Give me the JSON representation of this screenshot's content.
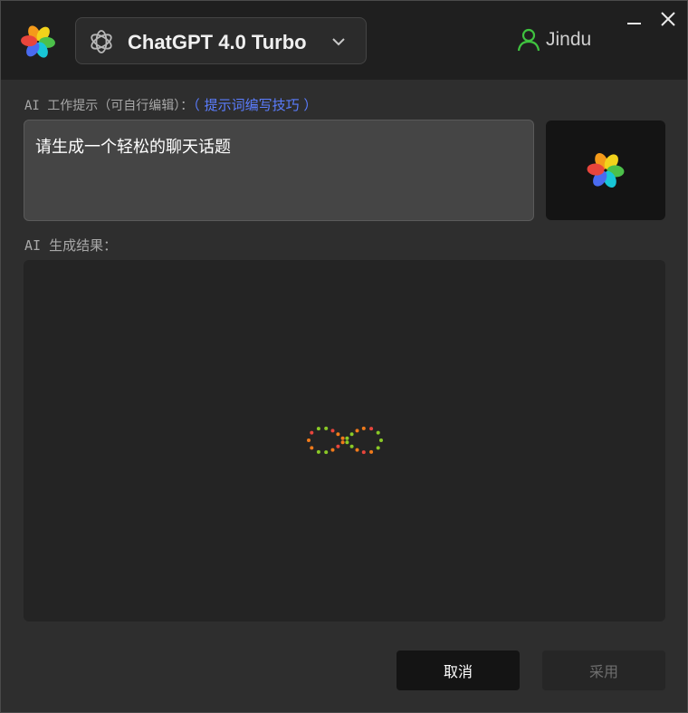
{
  "header": {
    "model_name": "ChatGPT 4.0 Turbo",
    "user_name": "Jindu"
  },
  "prompt": {
    "label_prefix": "AI 工作提示（可自行编辑）：",
    "tips_link": "（ 提示词编写技巧 ）",
    "value": "请生成一个轻松的聊天话题"
  },
  "result": {
    "label": "AI 生成结果："
  },
  "buttons": {
    "cancel": "取消",
    "apply": "采用"
  },
  "icons": {
    "logo": "flower-logo-icon",
    "model": "openai-icon",
    "dropdown": "chevron-down-icon",
    "user": "user-icon",
    "minimize": "minimize-icon",
    "close": "close-icon",
    "loading": "loading-infinity-spinner"
  },
  "colors": {
    "link": "#5b7dff",
    "user_icon": "#3fc23f",
    "petal_orange": "#f49a1a",
    "petal_red": "#e8453c",
    "petal_blue": "#4a6bf0",
    "petal_cyan": "#18c6d6",
    "petal_green": "#4cc04a",
    "petal_yellow": "#f2d21b"
  }
}
